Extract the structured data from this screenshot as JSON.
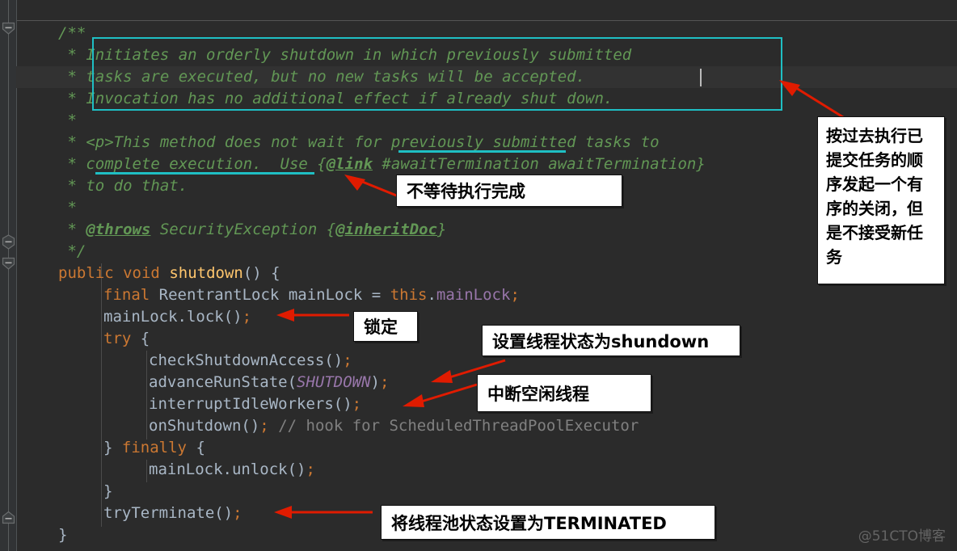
{
  "editor": {
    "theme_background": "#2B2B2B",
    "gutter_background": "#313335",
    "current_line_background": "#323232",
    "caret_color": "#BBBBBB",
    "highlight_color": "#1FBFC4",
    "arrow_color": "#E01B00",
    "code_lines": [
      {
        "indent": 0,
        "text": "/**"
      },
      {
        "indent": 0,
        "text": " * Initiates an orderly shutdown in which previously submitted"
      },
      {
        "indent": 0,
        "text": " * tasks are executed, but no new tasks will be accepted."
      },
      {
        "indent": 0,
        "text": " * Invocation has no additional effect if already shut down."
      },
      {
        "indent": 0,
        "text": " *"
      },
      {
        "indent": 0,
        "text": " * <p>This method does not wait for previously submitted tasks to"
      },
      {
        "indent": 0,
        "text": " * complete execution.  Use {@link #awaitTermination awaitTermination}"
      },
      {
        "indent": 0,
        "text": " * to do that."
      },
      {
        "indent": 0,
        "text": " *"
      },
      {
        "indent": 0,
        "text": " * @throws SecurityException {@inheritDoc}"
      },
      {
        "indent": 0,
        "text": " */"
      },
      {
        "indent": 0,
        "text": "public void shutdown() {"
      },
      {
        "indent": 1,
        "text": "final ReentrantLock mainLock = this.mainLock;"
      },
      {
        "indent": 1,
        "text": "mainLock.lock();"
      },
      {
        "indent": 1,
        "text": "try {"
      },
      {
        "indent": 2,
        "text": "checkShutdownAccess();"
      },
      {
        "indent": 2,
        "text": "advanceRunState(SHUTDOWN);"
      },
      {
        "indent": 2,
        "text": "interruptIdleWorkers();"
      },
      {
        "indent": 2,
        "text": "onShutdown(); // hook for ScheduledThreadPoolExecutor"
      },
      {
        "indent": 1,
        "text": "} finally {"
      },
      {
        "indent": 2,
        "text": "mainLock.unlock();"
      },
      {
        "indent": 1,
        "text": "}"
      },
      {
        "indent": 1,
        "text": "tryTerminate();"
      },
      {
        "indent": 0,
        "text": "}"
      }
    ],
    "tokens": {
      "doc_open": "/**",
      "doc_close": " */",
      "doc_star": " * ",
      "l1_text": "Initiates an orderly shutdown in which previously submitted",
      "l2_text": "tasks are executed, but no new tasks will be accepted.",
      "l3_text": "Invocation has no additional effect if already shut down.",
      "l5_p": "<p>",
      "l5_text": "This method does not wait for previously submitted tasks to",
      "l6_a": "complete execution.  Use {",
      "l6_link": "@link",
      "l6_b": " #awaitTermination awaitTermination}",
      "l7_text": "to do that.",
      "l9_throws": "@throws",
      "l9_rest": " SecurityException {",
      "l9_inherit": "@inheritDoc",
      "l9_end": "}",
      "kw_public": "public",
      "kw_void": "void",
      "m_shutdown": "shutdown",
      "parens_open_brace": "() {",
      "kw_final": "final",
      "t_reentrantlock": "ReentrantLock",
      "v_mainlock": "mainLock",
      "eq": "=",
      "kw_this": "this",
      "dot": ".",
      "f_mainlock": "mainLock",
      "semi": ";",
      "call_lock": "mainLock.lock()",
      "kw_try": "try",
      "brace_open": "{",
      "call_checkshutdownaccess": "checkShutdownAccess()",
      "call_advancerunstate_a": "advanceRunState(",
      "const_shutdown": "SHUTDOWN",
      "call_advancerunstate_b": ")",
      "call_interruptidleworkers": "interruptIdleWorkers()",
      "call_onshutdown": "onShutdown()",
      "comment_hook": "// hook for ScheduledThreadPoolExecutor",
      "brace_close": "}",
      "kw_finally": "finally",
      "call_unlock": "mainLock.unlock()",
      "call_tryterminate": "tryTerminate()"
    }
  },
  "annotations": {
    "right_note": "按过去执行已提交任务的顺序发起一个有序的关闭，但是不接受新任务",
    "right_note_lines": [
      "按过去执行已",
      "提交任务的顺",
      "序发起一个有",
      "序的关闭，但",
      "是不接受新任",
      "务"
    ],
    "no_wait": "不等待执行完成",
    "lock": "锁定",
    "set_state_shutdown": "设置线程状态为shundown",
    "interrupt_idle": "中断空闲线程",
    "set_pool_terminated": "将线程池状态设置为TERMINATED"
  },
  "watermark": {
    "text": "@51CTO博客"
  }
}
